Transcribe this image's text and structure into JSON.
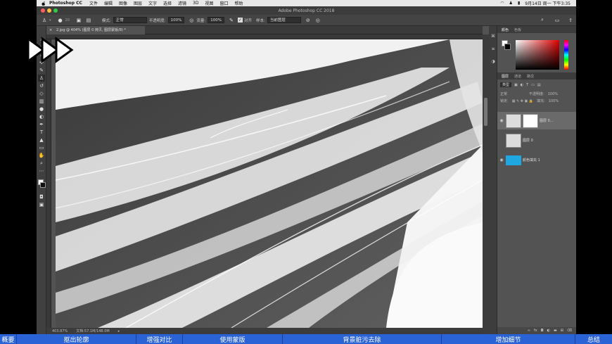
{
  "menubar": {
    "app_name": "Photoshop CC",
    "items": [
      "文件",
      "编辑",
      "图像",
      "图层",
      "文字",
      "选择",
      "滤镜",
      "3D",
      "视图",
      "窗口",
      "帮助"
    ],
    "clock": "9月14日 周一 下午3:35"
  },
  "window": {
    "title": "Adobe Photoshop CC 2018"
  },
  "options": {
    "brush_size": "20",
    "mode_label": "模式:",
    "mode_value": "正常",
    "opacity_label": "不透明度:",
    "opacity_value": "100%",
    "flow_label": "流量:",
    "flow_value": "100%",
    "aligned_label": "对齐",
    "sample_label": "样本:",
    "sample_value": "当前图层"
  },
  "document": {
    "tab_title": "2.jpg @ 404% (图层 0 拷贝, 图层蒙版/8) *",
    "zoom": "403.87%",
    "doc_size": "文档:57.1M/148.0M"
  },
  "colors": {
    "accent": "#2a63d6",
    "bg": "#535353",
    "fg_swatch": "#000000",
    "layer_fill": "#1ea7e0"
  },
  "panels": {
    "color_tabs": [
      "颜色",
      "色板"
    ],
    "layer_tabs": [
      "图层",
      "通道",
      "路径"
    ],
    "filter_label": "类型",
    "blend_mode": "正常",
    "opacity_label": "不透明度:",
    "opacity_value": "100%",
    "lock_label": "锁定:",
    "fill_label": "填充:",
    "fill_value": "100%",
    "layers": [
      {
        "name": "图层 0...",
        "selected": true
      },
      {
        "name": "图层 0",
        "selected": false
      },
      {
        "name": "颜色填充 1",
        "selected": false
      }
    ]
  },
  "chapters": [
    "概要",
    "抠出轮廓",
    "增强对比",
    "使用蒙版",
    "背景脏污去除",
    "增加细节",
    "总结"
  ]
}
